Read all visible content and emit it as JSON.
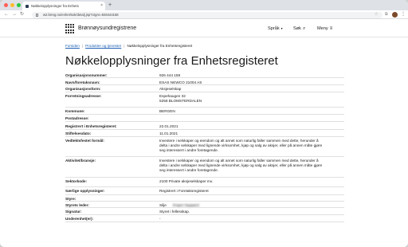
{
  "browser": {
    "tab_title": "Nøkkelopplysninger fra Enhets",
    "url": "w2.brreg.no/enhet/sok/detalj.jsp?orgnr=926444158",
    "traffic_colors": [
      "#ff5f57",
      "#febc2e",
      "#28c840"
    ]
  },
  "site": {
    "brand": "Brønnøysundregistrene",
    "nav": {
      "language": "Språk",
      "search": "Søk",
      "menu": "Meny"
    }
  },
  "breadcrumb": {
    "home": "Forsiden",
    "products": "Produkter og tjenester",
    "current": "Nøkkelopplysninger fra Enhetsregisteret"
  },
  "page_title": "Nøkkelopplysninger fra Enhetsregisteret",
  "details": [
    {
      "label": "Organisasjonsnummer:",
      "lines": [
        "926 444 158"
      ]
    },
    {
      "label": "Navn/foretaksnavn:",
      "lines": [
        "ESAS NEWCO 21004 AS"
      ]
    },
    {
      "label": "Organisasjonsform:",
      "lines": [
        "Aksjeselskap"
      ]
    },
    {
      "label": "Forretningsadresse:",
      "lines": [
        "Espehaugen 32",
        "5258 BLOMSTERDALEN"
      ]
    },
    {
      "label": "Kommune:",
      "lines": [
        "BERGEN"
      ]
    },
    {
      "label": "Postadresse:",
      "lines": []
    },
    {
      "label": "Registrert i Enhetsregisteret:",
      "lines": [
        "22.01.2021"
      ]
    },
    {
      "label": "Stiftelsesdato:",
      "lines": [
        "11.01.2021"
      ]
    },
    {
      "label": "Vedtektsfestet formål:",
      "lines": [
        "Investere i selskaper og eiendom og alt annet som naturlig faller  sammen med dette, herunder å",
        "delta i andre selskaper med lignende  virksomhet, kjøp og salg av aksjer, eller på annen måte gjøre",
        "seg  interessert i andre foretagende."
      ]
    },
    {
      "label": "Aktivitet/bransje:",
      "lines": [
        "Investere i selskaper og eiendom og alt annet som naturlig faller  sammen med dette, herunder å",
        "delta i andre selskaper med lignende  virksomhet, kjøp og salg av aksjer, eller på annen måte gjøre",
        "seg  interessert i andre foretagende."
      ]
    },
    {
      "label": "Sektorkode:",
      "lines": [
        "2100 Private aksjeselskaper mv."
      ]
    },
    {
      "label": "Særlige opplysninger:",
      "lines": [
        "Registrert i Foretaksregisteret"
      ]
    },
    {
      "label": "Styre:",
      "lines": []
    },
    {
      "label": "Styrets leder:",
      "lines": [
        "Silje",
        "Engen Nygaard"
      ]
    },
    {
      "label": "Signatur:",
      "lines": [
        "Styret i fellesskap."
      ]
    },
    {
      "label": "Underenhet(er):",
      "lines": [
        "-"
      ]
    }
  ]
}
